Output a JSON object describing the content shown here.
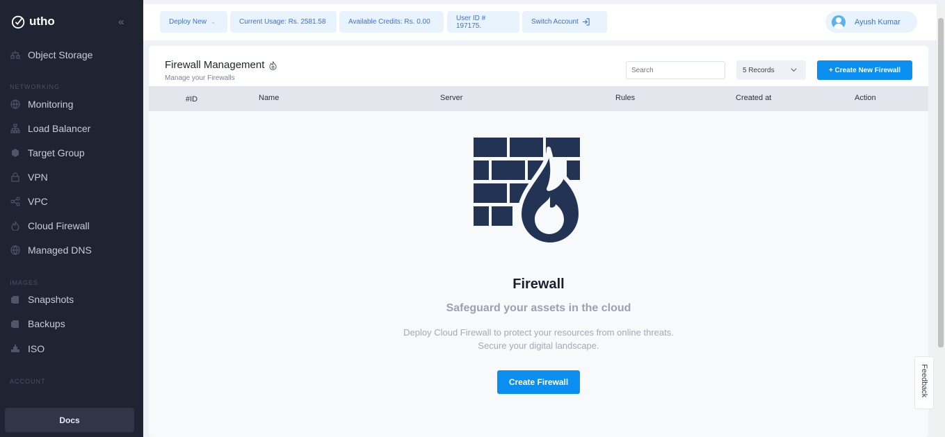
{
  "brand": {
    "name": "utho"
  },
  "sidebar": {
    "items_top": [
      {
        "label": "Object Storage",
        "icon": "storage-icon"
      }
    ],
    "sections": {
      "networking": "NETWORKING",
      "images": "IMAGES",
      "account": "ACCOUNT"
    },
    "networking_items": [
      {
        "label": "Monitoring",
        "icon": "globe-icon"
      },
      {
        "label": "Load Balancer",
        "icon": "sitemap-icon"
      },
      {
        "label": "Target Group",
        "icon": "target-icon"
      },
      {
        "label": "VPN",
        "icon": "lock-icon"
      },
      {
        "label": "VPC",
        "icon": "share-icon"
      },
      {
        "label": "Cloud Firewall",
        "icon": "flame-icon"
      },
      {
        "label": "Managed DNS",
        "icon": "globe-icon"
      }
    ],
    "images_items": [
      {
        "label": "Snapshots",
        "icon": "copy-icon"
      },
      {
        "label": "Backups",
        "icon": "copy-icon"
      },
      {
        "label": "ISO",
        "icon": "disc-icon"
      }
    ],
    "docs_label": "Docs"
  },
  "topbar": {
    "deploy_new": "Deploy New",
    "current_usage": "Current Usage: Rs. 2581.58",
    "available_credits": "Available Credits: Rs. 0.00",
    "user_id": "User ID # 197175.",
    "switch_account": "Switch Account",
    "user_name": "Ayush Kumar"
  },
  "main": {
    "title": "Firewall Management",
    "subtitle": "Manage your Firewalls",
    "search_placeholder": "Search",
    "records_select": "5 Records",
    "create_new_button": "+ Create New Firewall",
    "columns": [
      "#ID",
      "Name",
      "Server",
      "Rules",
      "Created at",
      "Action"
    ],
    "empty_state": {
      "title": "Firewall",
      "subtitle": "Safeguard your assets in the cloud",
      "description_line1": "Deploy Cloud Firewall to protect your resources from online threats.",
      "description_line2": "Secure your digital landscape.",
      "button": "Create Firewall"
    },
    "feedback_label": "Feedback"
  },
  "colors": {
    "sidebar_bg": "#1f2433",
    "accent": "#0a8ff0",
    "illustration": "#233354"
  }
}
